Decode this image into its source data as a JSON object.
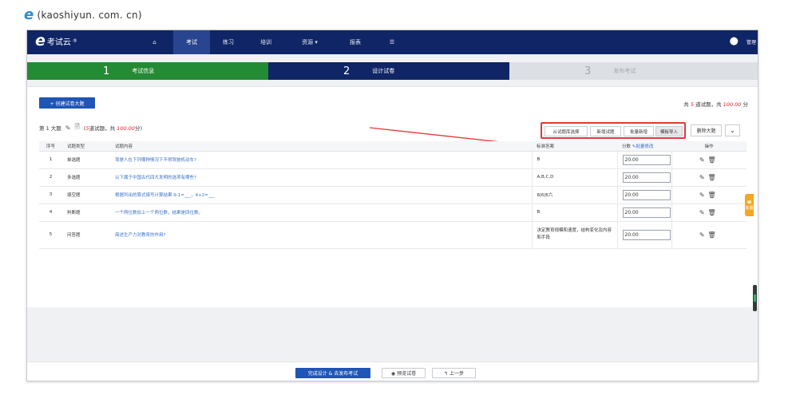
{
  "caption": {
    "text": "(kaoshiyun. com. cn)"
  },
  "nav": {
    "logo_name": "考试云",
    "logo_mark": "®",
    "items": [
      {
        "label": "⌂"
      },
      {
        "label": "考试"
      },
      {
        "label": "练习"
      },
      {
        "label": "培训"
      },
      {
        "label": "资源 ▾"
      },
      {
        "label": "报表"
      },
      {
        "label": "☰"
      }
    ],
    "user_icon": "user-circle-icon",
    "admin_label": "管理"
  },
  "steps": [
    {
      "num": "1",
      "label": "考试信息",
      "color": "#238b34"
    },
    {
      "num": "2",
      "label": "设计试卷",
      "color": "#0f2566"
    },
    {
      "num": "3",
      "label": "发布考试",
      "color": "#dcdfe4"
    }
  ],
  "toolbar": {
    "new_section": "+ 创建试卷大题",
    "total_prefix": "共",
    "total_count": "5",
    "total_mid": "道试题，共",
    "total_score": "100.00",
    "total_suffix": "分"
  },
  "section": {
    "title": "第 1 大题",
    "summary_open": "(",
    "summary_count": "5",
    "summary_mid": "道试题，共",
    "summary_score": "100.00",
    "summary_close": "分)"
  },
  "section_actions": {
    "from_bank": "从试题库选择",
    "add_question": "新增试题",
    "batch_add": "批量新增",
    "template_import": "模板导入",
    "delete_section": "删除大题",
    "collapse": "⌄"
  },
  "table": {
    "headers": {
      "no": "序号",
      "type": "试题类型",
      "content": "试题内容",
      "answer": "标准答案",
      "score": "分数",
      "batch_edit": "批量修改",
      "ops": "操作"
    },
    "rows": [
      {
        "no": "1",
        "type": "单选题",
        "content": "驾驶人在下列哪种情况下不得驾驶机动车?",
        "answer": "B",
        "score": "20.00"
      },
      {
        "no": "2",
        "type": "多选题",
        "content": "以下属于中国古代四大发明的选项有哪些?",
        "answer": "A,B,C,D",
        "score": "20.00"
      },
      {
        "no": "3",
        "type": "填空题",
        "content": "根据列出的算式填写计算结果.9-1=___，4+2=___",
        "answer": "8|6|6六",
        "score": "20.00"
      },
      {
        "no": "4",
        "type": "判断题",
        "content": "一个两位数加上一个两位数，结果是四位数。",
        "answer": "B",
        "score": "20.00"
      },
      {
        "no": "5",
        "type": "问答题",
        "content": "简述生产力对教育的作用?",
        "answer": "决定教育规模和速度，结构变化及内容和手段",
        "score": "20.00"
      }
    ]
  },
  "side": {
    "service_label": "客服"
  },
  "footer": {
    "finish": "完成设计 & 去发布考试",
    "preview": "◉ 预览试卷",
    "prev": "↰ 上一步"
  }
}
